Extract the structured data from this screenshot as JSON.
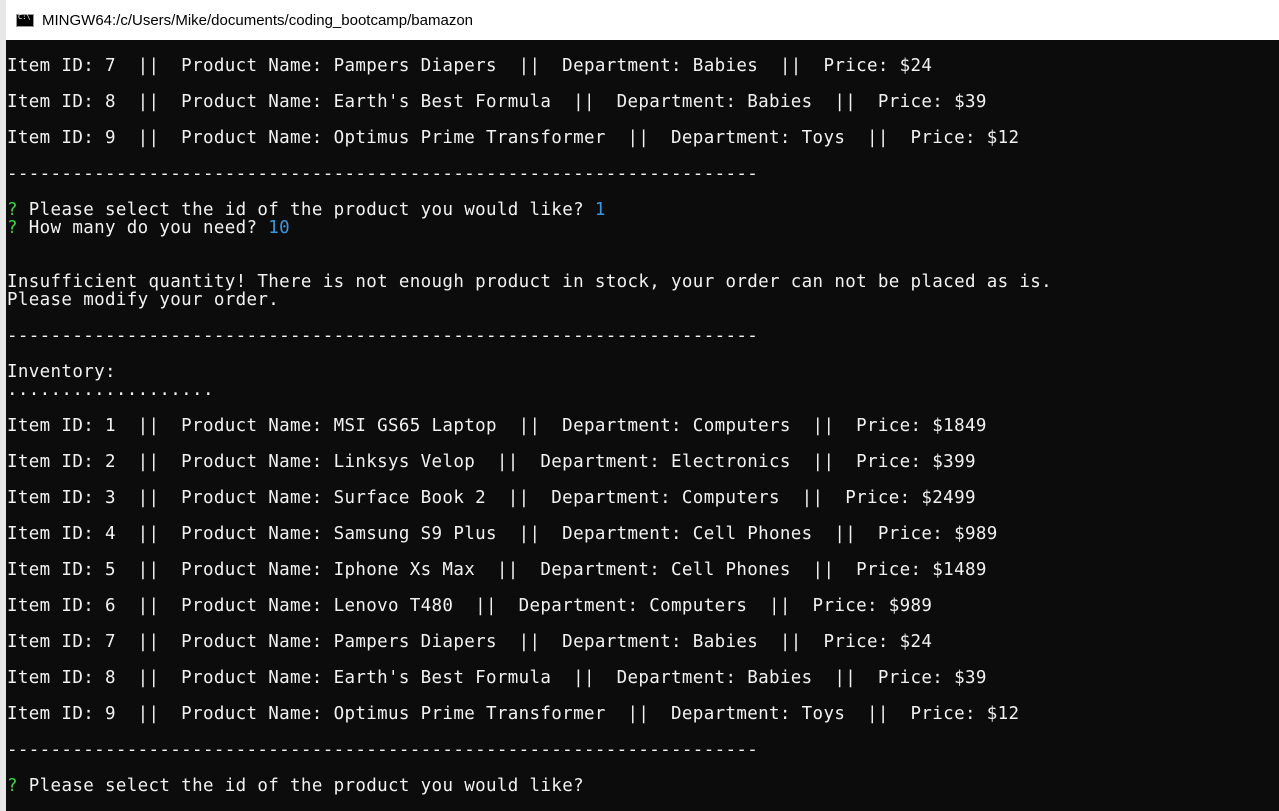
{
  "window": {
    "title": "MINGW64:/c/Users/Mike/documents/coding_bootcamp/bamazon"
  },
  "colors": {
    "background": "#0c0c0c",
    "text": "#f2f2f2",
    "prompt_mark": "#3ad63a",
    "answer": "#3a96dd"
  },
  "separator": "---------------------------------------------------------------------",
  "top_rows": [
    "Item ID: 7  ||  Product Name: Pampers Diapers  ||  Department: Babies  ||  Price: $24",
    "Item ID: 8  ||  Product Name: Earth's Best Formula  ||  Department: Babies  ||  Price: $39",
    "Item ID: 9  ||  Product Name: Optimus Prime Transformer  ||  Department: Toys  ||  Price: $12"
  ],
  "prompts": {
    "mark": "?",
    "select_question": "Please select the id of the product you would like?",
    "select_answer": "1",
    "quantity_question": "How many do you need?",
    "quantity_answer": "10"
  },
  "messages": {
    "insufficient_1": "Insufficient quantity! There is not enough product in stock, your order can not be placed as is.",
    "insufficient_2": "Please modify your order."
  },
  "inventory": {
    "label": "Inventory:",
    "dots": "...................",
    "rows": [
      "Item ID: 1  ||  Product Name: MSI GS65 Laptop  ||  Department: Computers  ||  Price: $1849",
      "Item ID: 2  ||  Product Name: Linksys Velop  ||  Department: Electronics  ||  Price: $399",
      "Item ID: 3  ||  Product Name: Surface Book 2  ||  Department: Computers  ||  Price: $2499",
      "Item ID: 4  ||  Product Name: Samsung S9 Plus  ||  Department: Cell Phones  ||  Price: $989",
      "Item ID: 5  ||  Product Name: Iphone Xs Max  ||  Department: Cell Phones  ||  Price: $1489",
      "Item ID: 6  ||  Product Name: Lenovo T480  ||  Department: Computers  ||  Price: $989",
      "Item ID: 7  ||  Product Name: Pampers Diapers  ||  Department: Babies  ||  Price: $24",
      "Item ID: 8  ||  Product Name: Earth's Best Formula  ||  Department: Babies  ||  Price: $39",
      "Item ID: 9  ||  Product Name: Optimus Prime Transformer  ||  Department: Toys  ||  Price: $12"
    ]
  }
}
